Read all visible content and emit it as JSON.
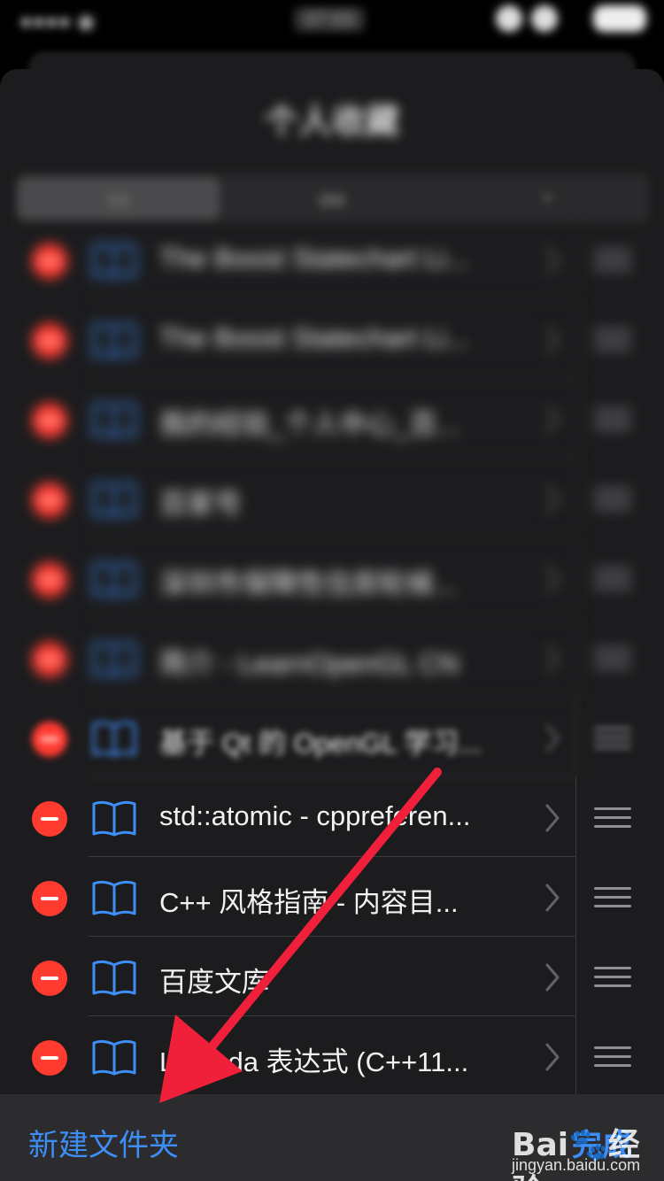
{
  "status_bar": {
    "time": "07:03"
  },
  "sheet": {
    "title": "个人收藏",
    "segments": [
      {
        "icon": "book-icon",
        "active": true
      },
      {
        "icon": "glasses-icon",
        "label": "oo",
        "active": false
      },
      {
        "icon": "clock-icon",
        "active": false
      }
    ]
  },
  "bookmarks": [
    {
      "title": "The Boost Statechart Li..."
    },
    {
      "title": "The Boost Statechart Li..."
    },
    {
      "title": "我的经验_个人中心_百..."
    },
    {
      "title": "百家号"
    },
    {
      "title": "深圳市保障性住房轮候..."
    },
    {
      "title": "简介 - LearnOpenGL CN"
    },
    {
      "title": "基于 Qt 的 OpenGL 学习..."
    },
    {
      "title": "std::atomic - cppreferen..."
    },
    {
      "title": "C++ 风格指南 - 内容目..."
    },
    {
      "title": "百度文库"
    },
    {
      "title": "Lambda 表达式 (C++11..."
    }
  ],
  "toolbar": {
    "new_folder_label": "新建文件夹",
    "done_label": "完成"
  },
  "watermark": {
    "logo": "Bai🐾经验",
    "url": "jingyan.baidu.com"
  },
  "colors": {
    "accent": "#3e8ef7",
    "delete": "#ff3b30",
    "annotation_arrow": "#f0203a"
  }
}
